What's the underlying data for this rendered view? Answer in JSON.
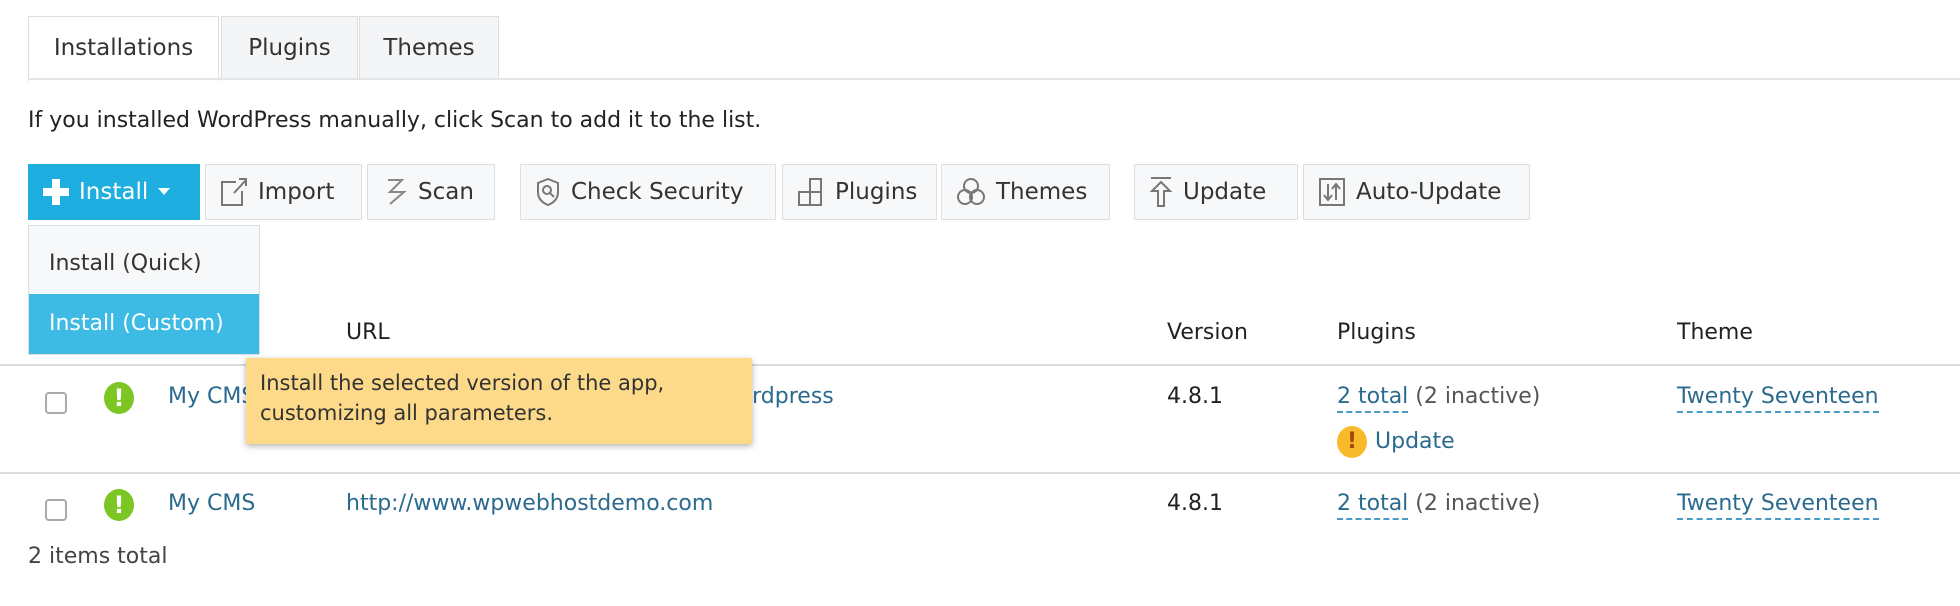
{
  "tabs": [
    {
      "label": "Installations",
      "active": true
    },
    {
      "label": "Plugins"
    },
    {
      "label": "Themes"
    }
  ],
  "hint": "If you installed WordPress manually, click Scan to add it to the list.",
  "toolbar": {
    "install": "Install",
    "import": "Import",
    "scan": "Scan",
    "check_security": "Check Security",
    "plugins": "Plugins",
    "themes": "Themes",
    "update": "Update",
    "auto_update": "Auto-Update"
  },
  "install_menu": {
    "items": [
      "Install (Quick)",
      "Install (Custom)"
    ],
    "selected": "Install (Custom)"
  },
  "tooltip": {
    "line1": "Install the selected version of the app,",
    "line2": "customizing all parameters."
  },
  "columns": {
    "url": "URL",
    "version": "Version",
    "plugins": "Plugins",
    "theme": "Theme"
  },
  "rows": [
    {
      "name": "My CMS",
      "url": "http://www.wpwebhostdemo.com/wordpress",
      "version": "4.8.1",
      "plugins_total": "2 total",
      "plugins_inactive": "(2 inactive)",
      "plugins_update": "Update",
      "theme": "Twenty Seventeen"
    },
    {
      "name": "My CMS",
      "url": "http://www.wpwebhostdemo.com",
      "version": "4.8.1",
      "plugins_total": "2 total",
      "plugins_inactive": "(2 inactive)",
      "theme": "Twenty Seventeen"
    }
  ],
  "footer": "2 items total",
  "colors": {
    "primary": "#1eaee0",
    "link": "#2b6a8f",
    "ok": "#7cc623",
    "warning": "#f8b92a",
    "tooltip": "#fdd98a"
  }
}
